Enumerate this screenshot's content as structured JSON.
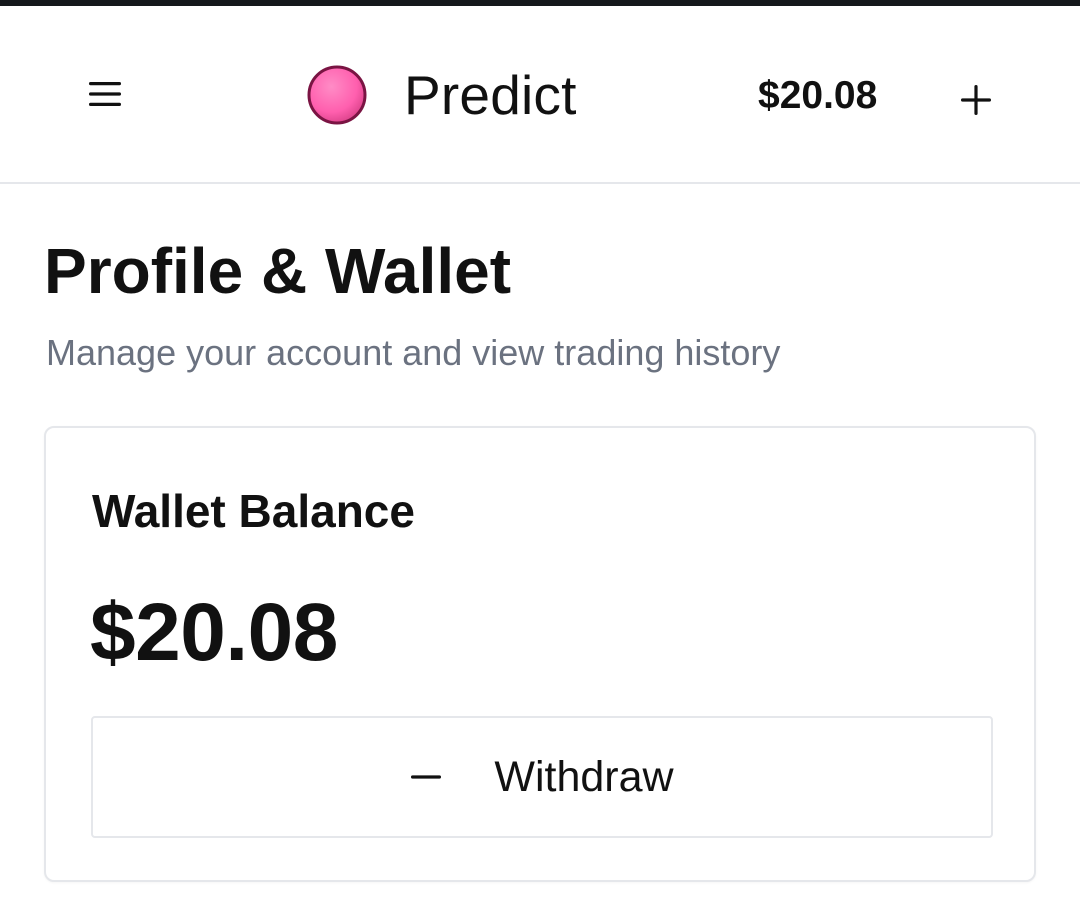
{
  "header": {
    "menu_icon": "hamburger-menu-icon",
    "brand_logo": "pink-circle-logo-icon",
    "brand_name": "Predict",
    "balance": "$20.08",
    "add_icon": "plus-icon"
  },
  "page": {
    "title": "Profile & Wallet",
    "subtitle": "Manage your account and view trading history"
  },
  "wallet": {
    "title": "Wallet Balance",
    "amount": "$20.08",
    "withdraw_icon": "minus-icon",
    "withdraw_label": "Withdraw"
  },
  "colors": {
    "top_strip": "#15181c",
    "logo_fill": "#ff5fae",
    "logo_stroke": "#7a1443",
    "subtitle": "#6b7280",
    "border": "#e5e7eb"
  }
}
